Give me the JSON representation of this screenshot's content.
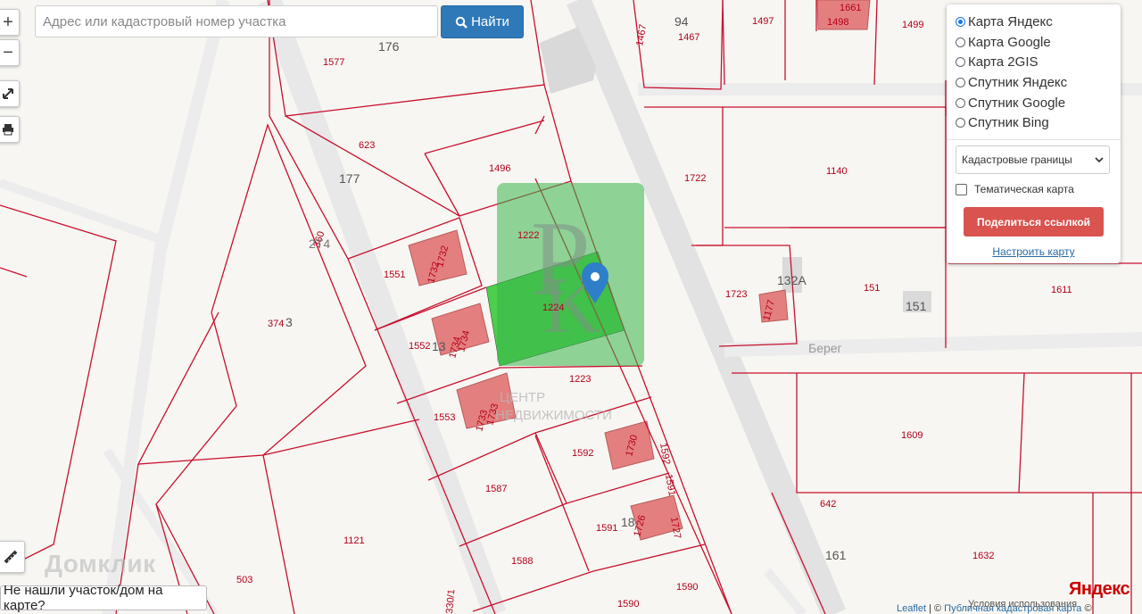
{
  "search": {
    "placeholder": "Адрес или кадастровый номер участка",
    "button_label": "Найти"
  },
  "controls": {
    "zoom_in": "+",
    "zoom_out": "−"
  },
  "layers_panel": {
    "options": [
      {
        "label": "Карта Яндекс",
        "selected": true
      },
      {
        "label": "Карта Google",
        "selected": false
      },
      {
        "label": "Карта 2GIS",
        "selected": false
      },
      {
        "label": "Спутник Яндекс",
        "selected": false
      },
      {
        "label": "Спутник Google",
        "selected": false
      },
      {
        "label": "Спутник Bing",
        "selected": false
      }
    ],
    "boundary_select": "Кадастровые границы",
    "thematic_label": "Тематическая карта",
    "thematic_checked": false,
    "share_button": "Поделиться ссылкой",
    "configure_link": "Настроить карту"
  },
  "not_found_button": "Не нашли участок/дом на карте?",
  "attribution": {
    "leaflet": "Leaflet",
    "separator": " | © ",
    "pkk": "Публичная кадастровая карта",
    "copy": " ©",
    "terms": "Условия использования"
  },
  "watermarks": {
    "domclick": "Домклик",
    "center_top": "ЦЕНТР",
    "center_bottom": "НЕДВИЖИМОСТИ",
    "yandex": "Яндекс"
  },
  "street_label": "Берег",
  "house_numbers": [
    "94",
    "176",
    "177",
    "132А",
    "151",
    "161",
    "3",
    "13",
    "18"
  ],
  "parcel_labels": [
    "1497",
    "1498",
    "1661",
    "1499",
    "1467",
    "1467",
    "1577",
    "623",
    "1496",
    "1722",
    "1140",
    "1222",
    "1551",
    "1732",
    "1732",
    "1224",
    "1723",
    "1177",
    "151",
    "1611",
    "360",
    "2Т4",
    "374",
    "1552",
    "1734",
    "1734",
    "1223",
    "1553",
    "1733",
    "1733",
    "1592",
    "1730",
    "1592",
    "1609",
    "1587",
    "1591",
    "1727",
    "1591",
    "1726",
    "642",
    "1632",
    "1588",
    "1121",
    "503",
    "330/1",
    "1590",
    "1590"
  ],
  "colors": {
    "boundary": "#c8102e",
    "selected_parcel": "#22c422",
    "building": "#e47f7f",
    "marker": "#2f7ec9",
    "brand_logo": "#39b54a"
  }
}
